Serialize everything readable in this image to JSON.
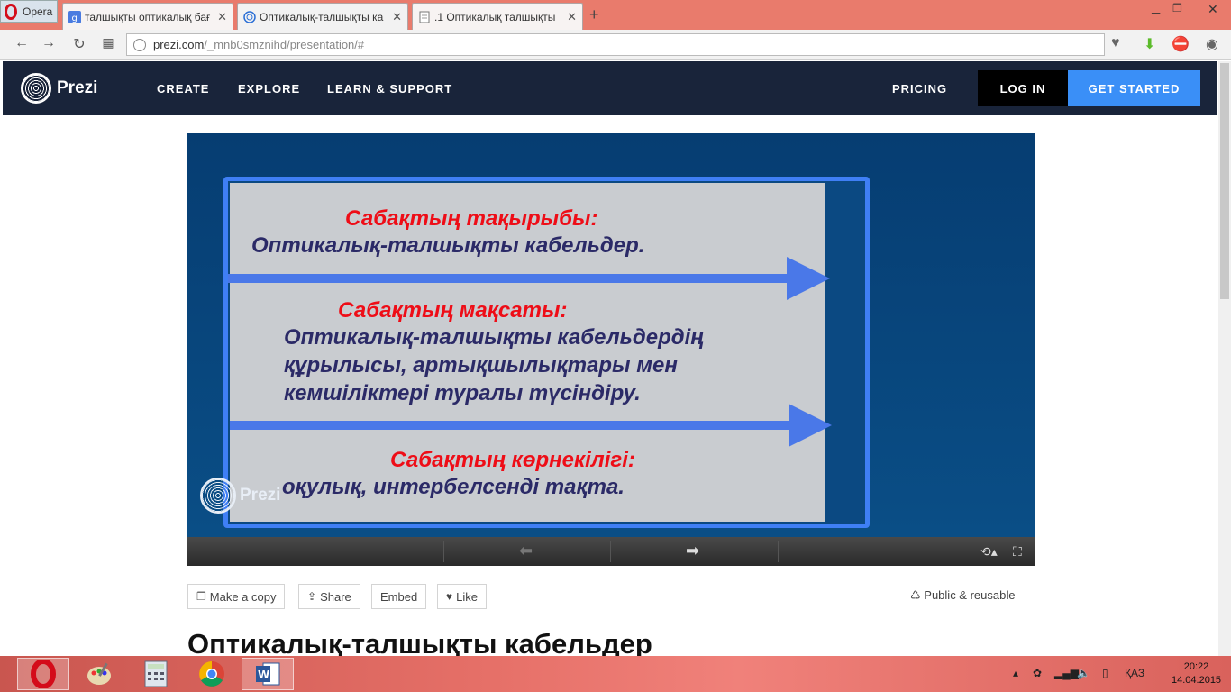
{
  "browser": {
    "opera_label": "Opera",
    "tabs": [
      {
        "title": "талшықты оптикалық бағ",
        "icon": "google-icon"
      },
      {
        "title": "Оптикалық-талшықты ка",
        "icon": "prezi-icon"
      },
      {
        "title": ".1 Оптикалық талшықты",
        "icon": "document-icon"
      }
    ],
    "new_tab": "+",
    "url_host": "prezi.com",
    "url_path": "/_mnb0smznihd/presentation/#"
  },
  "prezi_header": {
    "logo": "Prezi",
    "nav": [
      "CREATE",
      "EXPLORE",
      "LEARN & SUPPORT"
    ],
    "pricing": "PRICING",
    "login": "LOG IN",
    "get_started": "GET STARTED"
  },
  "slide": {
    "topic_label": "Сабақтың тақырыбы:",
    "topic_text": "Оптикалық-талшықты кабельдер.",
    "goal_label": "Сабақтың мақсаты:",
    "goal_lines": [
      "Оптикалық-талшықты кабельдердің",
      "құрылысы, артықшылықтары мен",
      "кемшіліктері туралы түсіндіру."
    ],
    "visual_label": "Сабақтың көрнекілігі:",
    "visual_text": "оқулық, интербелсенді тақта.",
    "watermark": "Prezi"
  },
  "actions": {
    "make_copy": "Make a copy",
    "share": "Share",
    "embed": "Embed",
    "like": "Like",
    "public": "Public & reusable"
  },
  "presentation_title": "Оптикалық-талшықты кабельдер",
  "taskbar": {
    "apps": [
      "opera-icon",
      "paint-icon",
      "calculator-icon",
      "chrome-icon",
      "word-icon"
    ],
    "language": "ҚАЗ",
    "time": "20:22",
    "date": "14.04.2015"
  }
}
